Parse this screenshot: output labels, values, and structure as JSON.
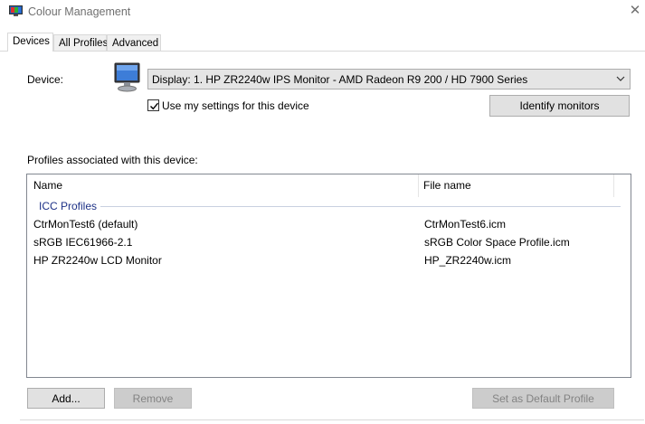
{
  "window": {
    "title": "Colour Management",
    "close_glyph": "✕"
  },
  "tabs": [
    {
      "label": "Devices",
      "active": true
    },
    {
      "label": "All Profiles",
      "active": false
    },
    {
      "label": "Advanced",
      "active": false
    }
  ],
  "device": {
    "label": "Device:",
    "selected": "Display: 1. HP ZR2240w IPS Monitor - AMD Radeon R9 200 / HD 7900 Series",
    "icon": "monitor-icon"
  },
  "use_my_settings": {
    "label": "Use my settings for this device",
    "checked": true
  },
  "identify_button": "Identify monitors",
  "profiles": {
    "label": "Profiles associated with this device:",
    "columns": [
      "Name",
      "File name"
    ],
    "group": "ICC Profiles",
    "rows": [
      {
        "name": "CtrMonTest6 (default)",
        "file": "CtrMonTest6.icm"
      },
      {
        "name": "sRGB IEC61966-2.1",
        "file": "sRGB Color Space Profile.icm"
      },
      {
        "name": "HP ZR2240w LCD Monitor",
        "file": "HP_ZR2240w.icm"
      }
    ]
  },
  "buttons": {
    "add": "Add...",
    "remove": "Remove",
    "set_default": "Set as Default Profile"
  },
  "colors": {
    "group_text": "#1e3287",
    "disabled_text": "#838383"
  }
}
